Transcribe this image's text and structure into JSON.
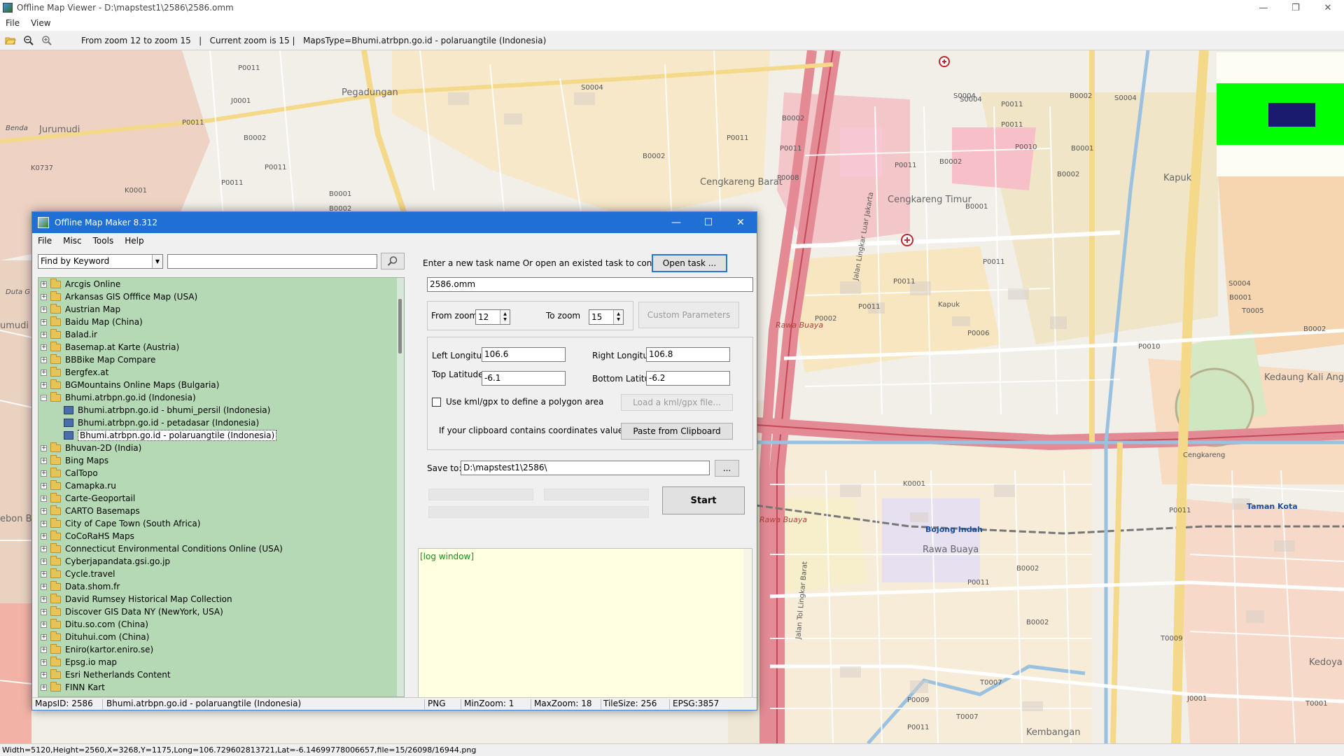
{
  "window": {
    "title": "Offline Map Viewer - D:\\mapstest1\\2586\\2586.omm",
    "menu": [
      "File",
      "View"
    ],
    "controls": {
      "minimize": "—",
      "restore": "❐",
      "close": "✕"
    }
  },
  "toolbar": {
    "status": "From zoom 12 to zoom 15   |   Current zoom is 15 |   MapsType=Bhumi.atrbpn.go.id - polaruangtile (Indonesia)"
  },
  "map": {
    "labels": [
      "P0011",
      "Pegadungan",
      "S0004",
      "Jurumudi",
      "J0001",
      "B0002",
      "P0011",
      "K0737",
      "K0001",
      "P0011",
      "P0011",
      "B0001",
      "B0002",
      "S0004",
      "P0011",
      "B0002",
      "P0011",
      "B0002",
      "B0002",
      "P0011",
      "P0008",
      "Cengkareng Barat",
      "P0011",
      "Cengkareng Timur",
      "B0002",
      "B0001",
      "S0004",
      "P0010",
      "S0004",
      "P0011",
      "B0001",
      "Kapuk",
      "B0002",
      "P0011",
      "S0004",
      "B0001",
      "B0002",
      "T0005",
      "Kedaung Kali Angke",
      "P0011",
      "P0002",
      "P0006",
      "P0011",
      "P0010",
      "Kapuk",
      "K0001",
      "Bojong Indah",
      "Rawa Buaya",
      "B0002",
      "P0011",
      "T0009",
      "T0007",
      "P0009",
      "T0007",
      "P0011",
      "Kembangan",
      "J0001",
      "T0001",
      "Kedoya",
      "Taman Kota",
      "Rawa Buaya",
      "Rawa Buaya",
      "Jalan Lingkar Luar Jakarta",
      "Jalan Tol Lingkar Barat",
      "Cengkareng",
      "P0011",
      "B0002",
      "Benda",
      "Duta G",
      "umudi",
      "ebon B"
    ],
    "overlay": {
      "green": "#00ff00",
      "navy": "#1a1a6e"
    }
  },
  "bottom_status": "Width=5120,Height=2560,X=3268,Y=1175,Long=106.729602813721,Lat=-6.14699778006657,file=15/26098/16944.png",
  "dialog": {
    "title": "Offline Map Maker 8.312",
    "menu": [
      "File",
      "Misc",
      "Tools",
      "Help"
    ],
    "controls": {
      "minimize": "—",
      "maximize": "☐",
      "close": "✕"
    },
    "find": {
      "select_value": "Find by Keyword",
      "input_value": ""
    },
    "tree": [
      {
        "label": "Arcgis Online",
        "type": "folder",
        "expanded": false
      },
      {
        "label": "Arkansas GIS Offfice Map (USA)",
        "type": "folder",
        "expanded": false
      },
      {
        "label": "Austrian Map",
        "type": "folder",
        "expanded": false
      },
      {
        "label": "Baidu Map (China)",
        "type": "folder",
        "expanded": false
      },
      {
        "label": "Balad.ir",
        "type": "folder",
        "expanded": false
      },
      {
        "label": "Basemap.at Karte (Austria)",
        "type": "folder",
        "expanded": false
      },
      {
        "label": "BBBike Map Compare",
        "type": "folder",
        "expanded": false
      },
      {
        "label": "Bergfex.at",
        "type": "folder",
        "expanded": false
      },
      {
        "label": "BGMountains Online Maps (Bulgaria)",
        "type": "folder",
        "expanded": false
      },
      {
        "label": "Bhumi.atrbpn.go.id (Indonesia)",
        "type": "folder",
        "expanded": true
      },
      {
        "label": "Bhumi.atrbpn.go.id - bhumi_persil (Indonesia)",
        "type": "map"
      },
      {
        "label": "Bhumi.atrbpn.go.id - petadasar (Indonesia)",
        "type": "map"
      },
      {
        "label": "Bhumi.atrbpn.go.id - polaruangtile (Indonesia)",
        "type": "map",
        "selected": true
      },
      {
        "label": "Bhuvan-2D (India)",
        "type": "folder",
        "expanded": false
      },
      {
        "label": "Bing Maps",
        "type": "folder",
        "expanded": false
      },
      {
        "label": "CalTopo",
        "type": "folder",
        "expanded": false
      },
      {
        "label": "Camapka.ru",
        "type": "folder",
        "expanded": false
      },
      {
        "label": "Carte-Geoportail",
        "type": "folder",
        "expanded": false
      },
      {
        "label": "CARTO Basemaps",
        "type": "folder",
        "expanded": false
      },
      {
        "label": "City of Cape Town (South Africa)",
        "type": "folder",
        "expanded": false
      },
      {
        "label": "CoCoRaHS Maps",
        "type": "folder",
        "expanded": false
      },
      {
        "label": "Connecticut Environmental Conditions Online (USA)",
        "type": "folder",
        "expanded": false
      },
      {
        "label": "Cyberjapandata.gsi.go.jp",
        "type": "folder",
        "expanded": false
      },
      {
        "label": "Cycle.travel",
        "type": "folder",
        "expanded": false
      },
      {
        "label": "Data.shom.fr",
        "type": "folder",
        "expanded": false
      },
      {
        "label": "David Rumsey Historical Map Collection",
        "type": "folder",
        "expanded": false
      },
      {
        "label": "Discover GIS Data NY (NewYork, USA)",
        "type": "folder",
        "expanded": false
      },
      {
        "label": "Ditu.so.com (China)",
        "type": "folder",
        "expanded": false
      },
      {
        "label": "Dituhui.com (China)",
        "type": "folder",
        "expanded": false
      },
      {
        "label": "Eniro(kartor.eniro.se)",
        "type": "folder",
        "expanded": false
      },
      {
        "label": "Epsg.io map",
        "type": "folder",
        "expanded": false
      },
      {
        "label": "Esri Netherlands Content",
        "type": "folder",
        "expanded": false
      },
      {
        "label": "FINN Kart",
        "type": "folder",
        "expanded": false
      }
    ],
    "task": {
      "prompt": "Enter a new task name Or open an existed task to continue:",
      "open_button": "Open task ...",
      "name": "2586.omm"
    },
    "zoom": {
      "from_label": "From zoom",
      "from_value": "12",
      "to_label": "To zoom",
      "to_value": "15",
      "custom_button": "Custom Parameters"
    },
    "coords": {
      "left_lon_label": "Left Longitude",
      "left_lon": "106.6",
      "right_lon_label": "Right Longitude",
      "right_lon": "106.8",
      "top_lat_label": "Top Latitude",
      "top_lat": "-6.1",
      "bottom_lat_label": "Bottom Latitude",
      "bottom_lat": "-6.2",
      "kml_label": "Use kml/gpx to define a polygon area",
      "kml_button": "Load a kml/gpx file...",
      "clipboard_label": "If your clipboard contains coordinates values:",
      "clipboard_button": "Paste from Clipboard"
    },
    "save": {
      "label": "Save to:",
      "path": "D:\\mapstest1\\2586\\",
      "browse": "..."
    },
    "start_button": "Start",
    "log": "[log window]",
    "status": {
      "maps_id": "MapsID: 2586",
      "map_name": "Bhumi.atrbpn.go.id - polaruangtile (Indonesia)",
      "format": "PNG",
      "min_zoom": "MinZoom: 1",
      "max_zoom": "MaxZoom: 18",
      "tile_size": "TileSize: 256",
      "epsg": "EPSG:3857"
    }
  }
}
